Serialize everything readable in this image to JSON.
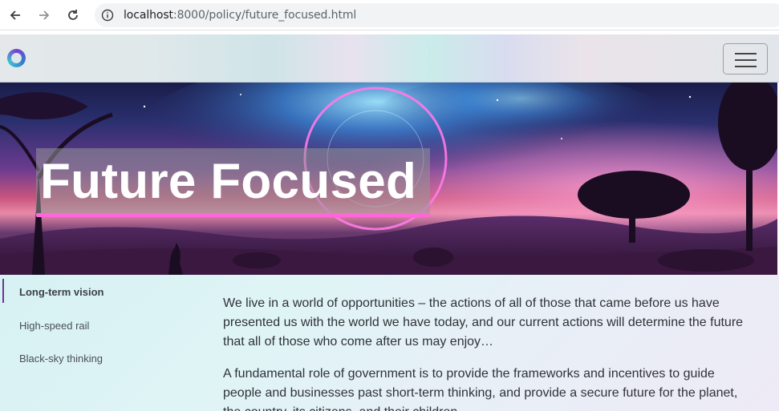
{
  "browser": {
    "url_host": "localhost",
    "url_path": ":8000/policy/future_focused.html"
  },
  "hero": {
    "title": "Future Focused"
  },
  "sidebar": {
    "items": [
      {
        "label": "Long-term vision",
        "active": true
      },
      {
        "label": "High-speed rail",
        "active": false
      },
      {
        "label": "Black-sky thinking",
        "active": false
      }
    ]
  },
  "main": {
    "paragraphs": [
      "We live in a world of opportunities – the actions of all of those that came before us have presented us with the world we have today, and our current actions will determine the future that all of those who come after us may enjoy…",
      "A fundamental role of government is to provide the frameworks and incentives to guide people and businesses past short-term thinking, and provide a secure future for the planet, the country, its citizens, and their children."
    ]
  },
  "colors": {
    "accent_underline": "#ff66d8",
    "active_marker": "#6a3a8e"
  },
  "icons": [
    "back-arrow-icon",
    "forward-arrow-icon",
    "reload-icon",
    "site-info-icon",
    "site-logo-icon",
    "menu-icon"
  ]
}
